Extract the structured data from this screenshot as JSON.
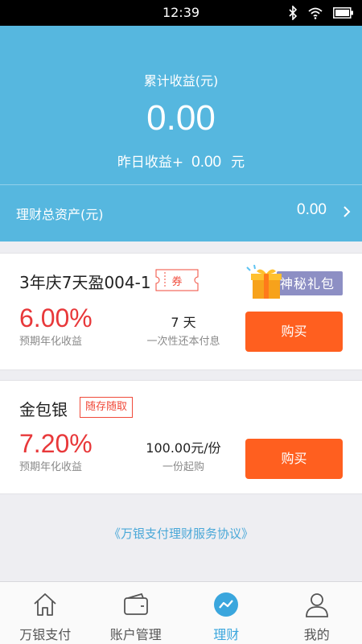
{
  "status_bar": {
    "time": "12:39"
  },
  "summary": {
    "cumulative_label": "累计收益(元)",
    "cumulative_value": "0.00",
    "yesterday_label": "昨日收益+",
    "yesterday_value": "0.00",
    "yesterday_unit": "元",
    "total_assets_label": "理财总资产(元)",
    "total_assets_value": "0.00"
  },
  "products": [
    {
      "name": "3年庆7天盈004-1",
      "coupon_label": "券",
      "gift_label": "神秘礼包",
      "rate": "6.00%",
      "rate_label": "预期年化收益",
      "term": "7 天",
      "term_sub": "一次性还本付息",
      "buy_label": "购买"
    },
    {
      "name": "金包银",
      "tag": "随存随取",
      "rate": "7.20%",
      "rate_label": "预期年化收益",
      "term": "100.00元/份",
      "term_sub": "一份起购",
      "buy_label": "购买"
    }
  ],
  "agreement": "《万银支付理财服务协议》",
  "tabs": [
    {
      "label": "万银支付",
      "icon": "home-icon"
    },
    {
      "label": "账户管理",
      "icon": "wallet-icon"
    },
    {
      "label": "理财",
      "icon": "trend-icon",
      "active": true
    },
    {
      "label": "我的",
      "icon": "user-icon"
    }
  ],
  "colors": {
    "header_bg": "#56b7df",
    "rate_red": "#e8383a",
    "buy_orange": "#ff5f1f",
    "active_tab": "#3aa6dd"
  }
}
